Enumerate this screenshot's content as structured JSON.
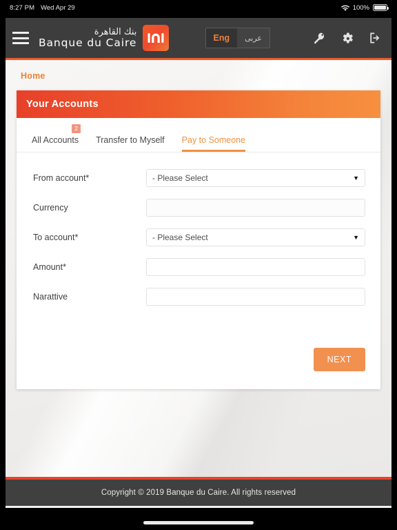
{
  "status_bar": {
    "time": "8:27 PM",
    "date": "Wed Apr 29",
    "wifi_icon": "wifi-icon",
    "battery_percent": "100%",
    "battery_icon": "battery-full-icon"
  },
  "navbar": {
    "menu_icon": "hamburger-menu-icon",
    "brand_arabic": "بنك القاهرة",
    "brand_english": "Banque du Caire",
    "logo_icon": "banque-du-caire-arch-logo",
    "language": {
      "english_label": "Eng",
      "arabic_label": "عربى",
      "active": "Eng"
    },
    "icons": {
      "key": "key-icon",
      "settings": "gear-icon",
      "logout": "sign-out-icon"
    },
    "accent_color": "#ef5a2a",
    "background_color": "#3d3d3d"
  },
  "breadcrumb": {
    "home_label": "Home"
  },
  "card": {
    "title": "Your Accounts",
    "header_gradient_from": "#e8402a",
    "header_gradient_to": "#f6903f",
    "tabs": [
      {
        "label": "All Accounts",
        "active": false,
        "badge": "2"
      },
      {
        "label": "Transfer to Myself",
        "active": false,
        "badge": ""
      },
      {
        "label": "Pay to Someone",
        "active": true,
        "badge": ""
      }
    ],
    "active_tab_color": "#f0913f"
  },
  "form": {
    "fields": [
      {
        "label": "From account*",
        "type": "select",
        "value": "- Please Select",
        "caret": "▼",
        "name": "from-account"
      },
      {
        "label": "Currency",
        "type": "text",
        "value": "",
        "name": "currency"
      },
      {
        "label": "To account*",
        "type": "select",
        "value": "- Please Select",
        "caret": "▼",
        "name": "to-account"
      },
      {
        "label": "Amount*",
        "type": "text",
        "value": "",
        "name": "amount"
      },
      {
        "label": "Narattive",
        "type": "text",
        "value": "",
        "name": "narrative"
      }
    ],
    "submit_label": "NEXT",
    "submit_color": "#f2904f"
  },
  "footer": {
    "copyright": "Copyright © 2019 Banque du Caire. All rights reserved",
    "background_color": "#404040",
    "accent_color": "#e8432a"
  }
}
